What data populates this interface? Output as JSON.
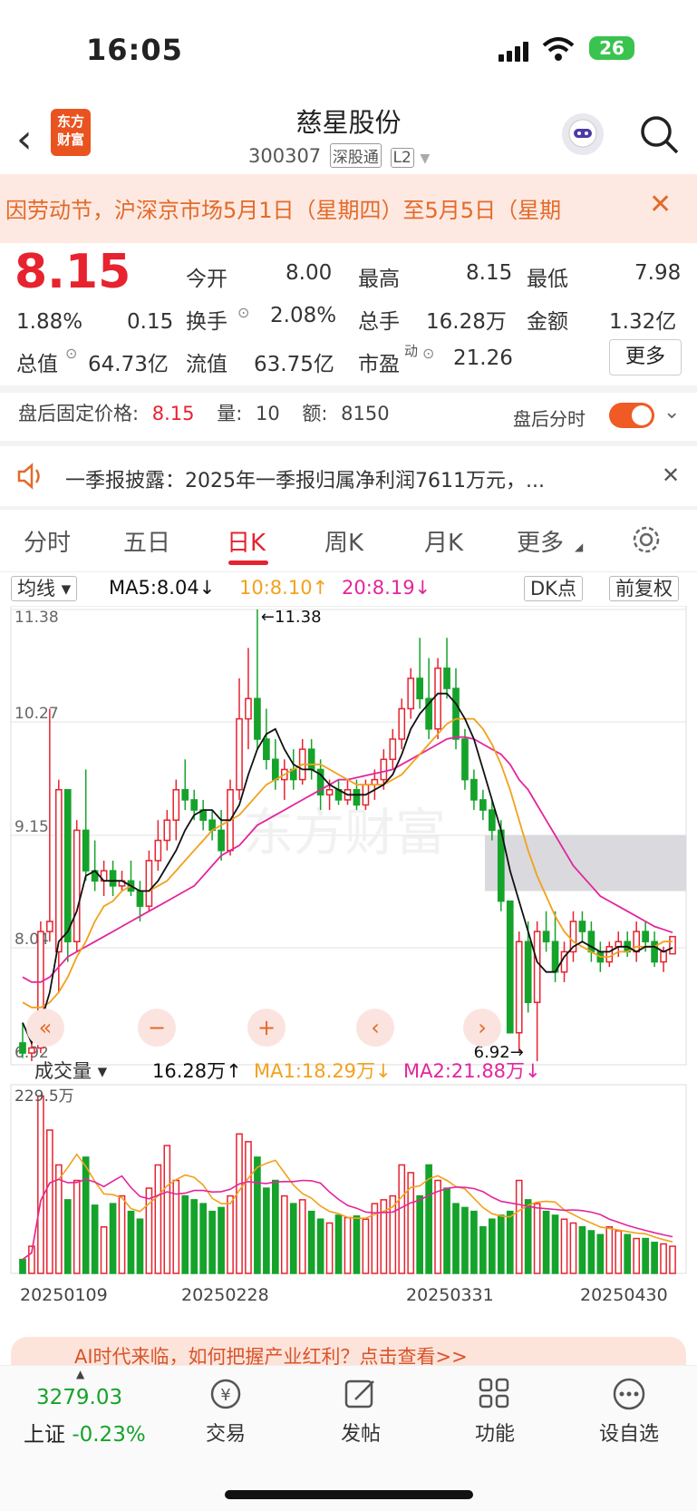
{
  "status": {
    "time": "16:05",
    "battery": "26"
  },
  "header": {
    "name": "慈星股份",
    "code": "300307",
    "tag1": "深股通",
    "tag2": "L2",
    "logo_top": "东方",
    "logo_bottom": "财富"
  },
  "banner": {
    "text": "因劳动节，沪深京市场5月1日（星期四）至5月5日（星期"
  },
  "quote": {
    "price": "8.15",
    "pct": "1.88%",
    "chg": "0.15",
    "open_label": "今开",
    "open": "8.00",
    "high_label": "最高",
    "high": "8.15",
    "low_label": "最低",
    "low": "7.98",
    "turnover_label": "换手",
    "turnover": "2.08%",
    "vol_label": "总手",
    "vol": "16.28万",
    "amt_label": "金额",
    "amt": "1.32亿",
    "mcap_label": "总值",
    "mcap": "64.73亿",
    "float_label": "流值",
    "float": "63.75亿",
    "pe_label": "市盈",
    "pe_sup": "动",
    "pe": "21.26",
    "more": "更多"
  },
  "after_hours": {
    "label": "盘后固定价格:",
    "price": "8.15",
    "vol_label": "量:",
    "vol": "10",
    "amt_label": "额:",
    "amt": "8150",
    "time_label": "盘后分时"
  },
  "notice": {
    "text": "一季报披露：2025年一季报归属净利润7611万元，..."
  },
  "tabs": [
    "分时",
    "五日",
    "日K",
    "周K",
    "月K",
    "更多"
  ],
  "indicators": {
    "ma_select": "均线",
    "ma5": "MA5:8.04↓",
    "ma10": "10:8.10↑",
    "ma20": "20:8.19↓",
    "dk": "DK点",
    "fq": "前复权"
  },
  "kline": {
    "y_labels": [
      "11.38",
      "10.27",
      "9.15",
      "8.04",
      "6.92"
    ],
    "max_label": "←11.38",
    "min_label": "6.92→",
    "watermark": "东方财富"
  },
  "volume": {
    "select": "成交量",
    "value": "16.28万↑",
    "ma1": "MA1:18.29万↓",
    "ma2": "MA2:21.88万↓",
    "max": "229.5万",
    "dates": [
      "20250109",
      "20250228",
      "20250331",
      "20250430"
    ]
  },
  "ai_bar": {
    "text": "AI时代来临，如何把握产业红利？点击查看>>"
  },
  "bottom": {
    "index_value": "3279.03",
    "index_name": "上证",
    "index_pct": "-0.23%",
    "trade": "交易",
    "post": "发帖",
    "func": "功能",
    "watch": "设自选"
  },
  "colors": {
    "up": "#e6232f",
    "down": "#15a32b",
    "ma5": "#111111",
    "ma10": "#f2a11b",
    "ma20": "#e3259c"
  },
  "chart_data": {
    "type": "candlestick",
    "title": "慈星股份 日K",
    "ylim": [
      6.92,
      11.38
    ],
    "candles": [
      [
        7.1,
        7.3,
        6.95,
        7.0
      ],
      [
        7.0,
        7.1,
        6.92,
        7.05
      ],
      [
        7.05,
        8.3,
        7.0,
        8.2
      ],
      [
        8.2,
        10.4,
        8.1,
        8.3
      ],
      [
        8.0,
        9.7,
        7.6,
        9.6
      ],
      [
        9.6,
        9.6,
        7.9,
        8.1
      ],
      [
        8.1,
        9.3,
        8.0,
        9.2
      ],
      [
        9.2,
        9.8,
        8.7,
        8.8
      ],
      [
        8.8,
        9.1,
        8.6,
        8.7
      ],
      [
        8.7,
        8.9,
        8.55,
        8.8
      ],
      [
        8.8,
        8.9,
        8.55,
        8.65
      ],
      [
        8.65,
        8.8,
        8.6,
        8.7
      ],
      [
        8.7,
        8.9,
        8.55,
        8.6
      ],
      [
        8.6,
        8.7,
        8.3,
        8.45
      ],
      [
        8.45,
        9.0,
        8.4,
        8.9
      ],
      [
        8.9,
        9.3,
        8.8,
        9.1
      ],
      [
        9.1,
        9.4,
        9.0,
        9.3
      ],
      [
        9.3,
        9.7,
        9.1,
        9.6
      ],
      [
        9.6,
        9.9,
        9.4,
        9.5
      ],
      [
        9.5,
        9.6,
        9.3,
        9.4
      ],
      [
        9.4,
        9.5,
        9.2,
        9.3
      ],
      [
        9.3,
        9.4,
        9.1,
        9.2
      ],
      [
        9.2,
        9.4,
        8.9,
        9.0
      ],
      [
        9.0,
        9.7,
        8.95,
        9.6
      ],
      [
        9.6,
        10.7,
        9.5,
        10.3
      ],
      [
        10.3,
        11.0,
        10.0,
        10.5
      ],
      [
        10.5,
        11.38,
        10.0,
        10.1
      ],
      [
        10.1,
        10.4,
        9.8,
        9.9
      ],
      [
        9.9,
        10.1,
        9.6,
        9.7
      ],
      [
        9.7,
        9.9,
        9.5,
        9.8
      ],
      [
        9.8,
        10.0,
        9.6,
        9.7
      ],
      [
        9.7,
        10.1,
        9.65,
        10.0
      ],
      [
        10.0,
        10.1,
        9.7,
        9.8
      ],
      [
        9.8,
        9.9,
        9.4,
        9.55
      ],
      [
        9.55,
        9.7,
        9.4,
        9.6
      ],
      [
        9.6,
        9.7,
        9.45,
        9.5
      ],
      [
        9.5,
        9.7,
        9.45,
        9.6
      ],
      [
        9.6,
        9.7,
        9.4,
        9.45
      ],
      [
        9.45,
        9.7,
        9.4,
        9.65
      ],
      [
        9.65,
        9.8,
        9.5,
        9.7
      ],
      [
        9.7,
        10.0,
        9.6,
        9.9
      ],
      [
        9.9,
        10.2,
        9.8,
        10.1
      ],
      [
        10.1,
        10.5,
        10.0,
        10.4
      ],
      [
        10.4,
        10.8,
        10.3,
        10.7
      ],
      [
        10.7,
        11.1,
        10.4,
        10.5
      ],
      [
        10.5,
        10.9,
        10.1,
        10.2
      ],
      [
        10.2,
        10.9,
        10.1,
        10.8
      ],
      [
        10.8,
        11.1,
        10.5,
        10.6
      ],
      [
        10.6,
        10.8,
        10.0,
        10.1
      ],
      [
        10.1,
        10.2,
        9.6,
        9.7
      ],
      [
        9.7,
        9.8,
        9.4,
        9.5
      ],
      [
        9.5,
        9.6,
        9.3,
        9.4
      ],
      [
        9.4,
        9.5,
        9.1,
        9.2
      ],
      [
        9.2,
        9.3,
        8.4,
        8.5
      ],
      [
        8.5,
        8.5,
        7.2,
        7.2
      ],
      [
        7.2,
        8.2,
        7.0,
        8.1
      ],
      [
        8.1,
        8.3,
        7.4,
        7.5
      ],
      [
        7.5,
        8.3,
        6.92,
        8.2
      ],
      [
        8.2,
        8.4,
        8.0,
        8.1
      ],
      [
        8.1,
        8.4,
        7.7,
        7.8
      ],
      [
        7.8,
        8.1,
        7.7,
        8.0
      ],
      [
        8.0,
        8.4,
        7.9,
        8.3
      ],
      [
        8.3,
        8.4,
        8.1,
        8.2
      ],
      [
        8.2,
        8.3,
        7.9,
        8.0
      ],
      [
        8.0,
        8.1,
        7.8,
        7.9
      ],
      [
        7.9,
        8.1,
        7.85,
        8.05
      ],
      [
        8.05,
        8.2,
        7.95,
        8.1
      ],
      [
        8.1,
        8.2,
        7.95,
        8.0
      ],
      [
        8.0,
        8.3,
        7.9,
        8.2
      ],
      [
        8.2,
        8.3,
        8.0,
        8.1
      ],
      [
        8.1,
        8.2,
        7.85,
        7.9
      ],
      [
        7.9,
        8.05,
        7.8,
        8.0
      ],
      [
        7.98,
        8.15,
        7.98,
        8.15
      ]
    ],
    "ma5": [
      7.3,
      7.1,
      7.3,
      7.6,
      8.1,
      8.2,
      8.4,
      8.75,
      8.8,
      8.7,
      8.7,
      8.7,
      8.65,
      8.6,
      8.6,
      8.7,
      8.85,
      9.0,
      9.2,
      9.35,
      9.4,
      9.4,
      9.3,
      9.3,
      9.45,
      9.75,
      10.0,
      10.15,
      10.2,
      10.0,
      9.85,
      9.8,
      9.8,
      9.75,
      9.65,
      9.6,
      9.55,
      9.55,
      9.55,
      9.6,
      9.65,
      9.75,
      9.95,
      10.2,
      10.35,
      10.45,
      10.55,
      10.55,
      10.45,
      10.3,
      10.1,
      9.8,
      9.5,
      9.2,
      8.8,
      8.5,
      8.2,
      7.9,
      7.8,
      7.8,
      7.95,
      8.05,
      8.1,
      8.05,
      8.0,
      8.0,
      8.05,
      8.05,
      8.0,
      8.05,
      8.05,
      8.0,
      8.04
    ],
    "ma10": [
      7.5,
      7.45,
      7.45,
      7.5,
      7.6,
      7.75,
      7.95,
      8.1,
      8.3,
      8.45,
      8.5,
      8.6,
      8.65,
      8.6,
      8.6,
      8.65,
      8.7,
      8.8,
      8.9,
      9.0,
      9.1,
      9.2,
      9.25,
      9.3,
      9.35,
      9.45,
      9.55,
      9.65,
      9.7,
      9.75,
      9.8,
      9.85,
      9.85,
      9.85,
      9.8,
      9.75,
      9.7,
      9.65,
      9.65,
      9.65,
      9.65,
      9.7,
      9.75,
      9.85,
      9.95,
      10.05,
      10.15,
      10.25,
      10.3,
      10.3,
      10.3,
      10.2,
      10.05,
      9.85,
      9.6,
      9.3,
      9.0,
      8.75,
      8.55,
      8.35,
      8.2,
      8.1,
      8.05,
      8.0,
      7.95,
      7.95,
      8.0,
      8.0,
      8.05,
      8.05,
      8.05,
      8.1,
      8.1
    ],
    "ma20": [
      7.75,
      7.7,
      7.7,
      7.75,
      7.85,
      7.95,
      8.0,
      8.05,
      8.1,
      8.15,
      8.2,
      8.25,
      8.3,
      8.35,
      8.4,
      8.45,
      8.5,
      8.55,
      8.6,
      8.65,
      8.75,
      8.85,
      8.95,
      9.0,
      9.05,
      9.15,
      9.25,
      9.3,
      9.35,
      9.4,
      9.45,
      9.5,
      9.55,
      9.6,
      9.65,
      9.7,
      9.7,
      9.72,
      9.74,
      9.76,
      9.78,
      9.8,
      9.85,
      9.9,
      9.95,
      10.0,
      10.05,
      10.1,
      10.12,
      10.12,
      10.1,
      10.05,
      10.0,
      9.95,
      9.85,
      9.7,
      9.6,
      9.45,
      9.3,
      9.15,
      9.0,
      8.85,
      8.75,
      8.65,
      8.55,
      8.5,
      8.45,
      8.4,
      8.35,
      8.3,
      8.25,
      8.22,
      8.19
    ],
    "volume": [
      18,
      35,
      229,
      185,
      140,
      95,
      120,
      150,
      88,
      60,
      90,
      100,
      80,
      70,
      110,
      140,
      165,
      120,
      100,
      95,
      90,
      80,
      85,
      100,
      180,
      170,
      150,
      110,
      120,
      100,
      90,
      95,
      80,
      70,
      65,
      75,
      72,
      74,
      70,
      90,
      95,
      100,
      140,
      130,
      100,
      140,
      120,
      110,
      90,
      85,
      80,
      60,
      70,
      75,
      80,
      120,
      95,
      90,
      80,
      75,
      70,
      65,
      60,
      55,
      50,
      60,
      55,
      50,
      45,
      45,
      40,
      38,
      35
    ],
    "dates": [
      "20250109",
      "20250228",
      "20250331",
      "20250430"
    ]
  }
}
